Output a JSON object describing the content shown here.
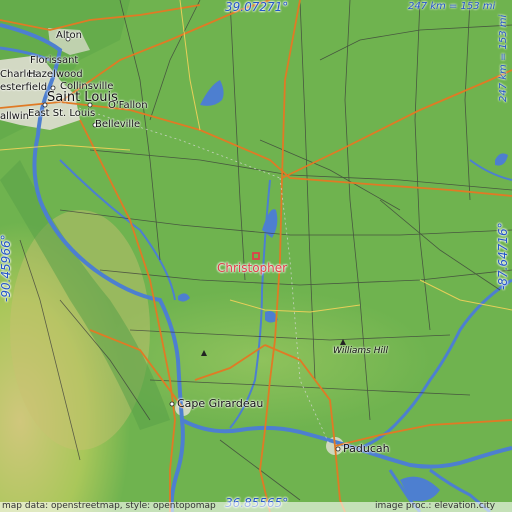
{
  "coordinates": {
    "top": "39.07271°",
    "bottom": "36.85565°",
    "left": "-90.45966°",
    "right": "-87.64716°"
  },
  "scale": {
    "horizontal": "247 km = 153 mi",
    "vertical": "247 km = 153 mi"
  },
  "focus_place": "Christopher",
  "places": {
    "alton": "Alton",
    "florissant": "Florissant",
    "charles": "Charles",
    "hazelwood": "Hazelwood",
    "chesterfield": "esterfield",
    "collinsville": "Collinsville",
    "saint_louis": "Saint Louis",
    "ballwin": "allwin",
    "east_st_louis": "East St. Louis",
    "ofallon": "O'Fallon",
    "belleville": "Belleville",
    "cape_girardeau": "Cape Girardeau",
    "paducah": "Paducah"
  },
  "peaks": {
    "williams_hill": "Williams Hill"
  },
  "credits": {
    "map_data": "map data: openstreetmap, style: opentopomap",
    "image": "image proc.: elevation.city"
  },
  "colors": {
    "lowland": "#6fb34f",
    "upland": "#a9c75a",
    "water": "#4d7fd0",
    "road_major": "#e07a25",
    "road_minor": "#3a3a3a",
    "urban": "#e6e1d9",
    "focus_marker": "#e0404a"
  }
}
